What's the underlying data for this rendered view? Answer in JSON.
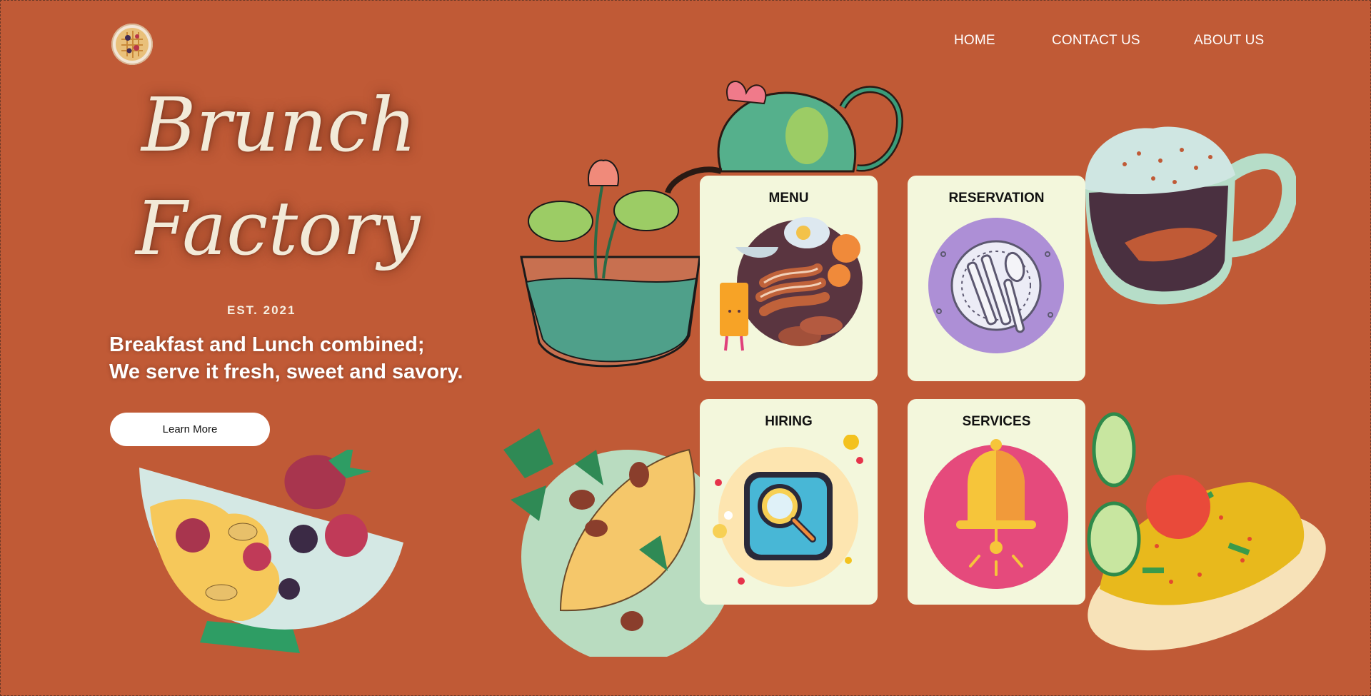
{
  "header": {
    "logo_icon": "waffle-logo-icon",
    "nav": [
      {
        "label": "HOME"
      },
      {
        "label": "CONTACT US"
      },
      {
        "label": "ABOUT US"
      }
    ]
  },
  "hero": {
    "brand_line1": "Brunch",
    "brand_line2": "Factory",
    "est": "EST. 2021",
    "tagline_line1": "Breakfast and Lunch combined;",
    "tagline_line2": "We serve it fresh, sweet and savory.",
    "cta_label": "Learn More"
  },
  "cards": [
    {
      "title": "MENU",
      "icon": "breakfast-plate-icon"
    },
    {
      "title": "RESERVATION",
      "icon": "plate-cutlery-icon"
    },
    {
      "title": "HIRING",
      "icon": "magnifier-icon"
    },
    {
      "title": "SERVICES",
      "icon": "service-bell-icon"
    }
  ],
  "colors": {
    "background": "#c05a36",
    "card": "#f3f7dc",
    "text_light": "#f2ead8",
    "button": "#ffffff"
  },
  "decor": [
    "fruit-bowl-illustration",
    "plant-teacup-illustration",
    "teapot-illustration",
    "coffee-mug-illustration",
    "omelette-plate-illustration",
    "rice-plate-illustration"
  ]
}
